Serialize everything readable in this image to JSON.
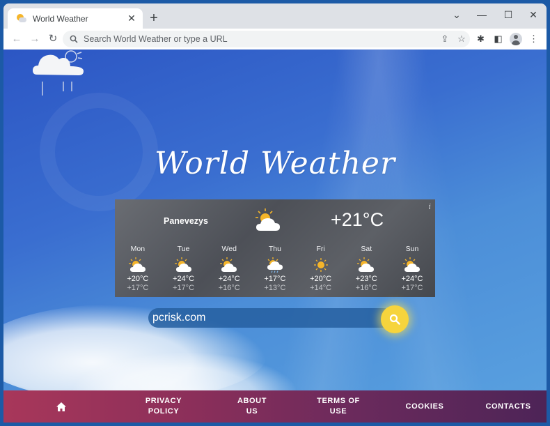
{
  "browser": {
    "tab_title": "World Weather",
    "tab_close": "✕",
    "new_tab": "+",
    "omnibox_placeholder": "Search World Weather or type a URL",
    "controls": {
      "dropdown": "⌄",
      "minimize": "—",
      "maximize": "☐",
      "close": "✕"
    },
    "nav": {
      "back": "←",
      "forward": "→",
      "reload": "↻"
    },
    "icons": {
      "search": "🔍",
      "share": "⇪",
      "bookmark": "☆",
      "extensions": "✱",
      "sidepanel": "◧",
      "menu": "⋮"
    }
  },
  "site": {
    "title": "World Weather",
    "info": "i"
  },
  "weather": {
    "city": "Panevezys",
    "current_temp": "+21°C",
    "current_icon": "sun-cloud-icon",
    "forecast": [
      {
        "day": "Mon",
        "icon": "partly-cloudy",
        "high": "+20°C",
        "low": "+17°C"
      },
      {
        "day": "Tue",
        "icon": "partly-cloudy",
        "high": "+24°C",
        "low": "+17°C"
      },
      {
        "day": "Wed",
        "icon": "partly-cloudy",
        "high": "+24°C",
        "low": "+16°C"
      },
      {
        "day": "Thu",
        "icon": "rain-sun",
        "high": "+17°C",
        "low": "+13°C"
      },
      {
        "day": "Fri",
        "icon": "sunny",
        "high": "+20°C",
        "low": "+14°C"
      },
      {
        "day": "Sat",
        "icon": "partly-cloudy",
        "high": "+23°C",
        "low": "+16°C"
      },
      {
        "day": "Sun",
        "icon": "partly-cloudy",
        "high": "+24°C",
        "low": "+17°C"
      }
    ]
  },
  "search": {
    "value": "pcrisk.com"
  },
  "footer": {
    "home": "⌂",
    "items": [
      "PRIVACY\nPOLICY",
      "ABOUT\nUS",
      "TERMS OF\nUSE",
      "COOKIES",
      "CONTACTS"
    ]
  },
  "colors": {
    "accent_yellow": "#f6d43d",
    "footer_start": "#a8375a",
    "footer_end": "#4d2457",
    "sun": "#f5b52a"
  }
}
